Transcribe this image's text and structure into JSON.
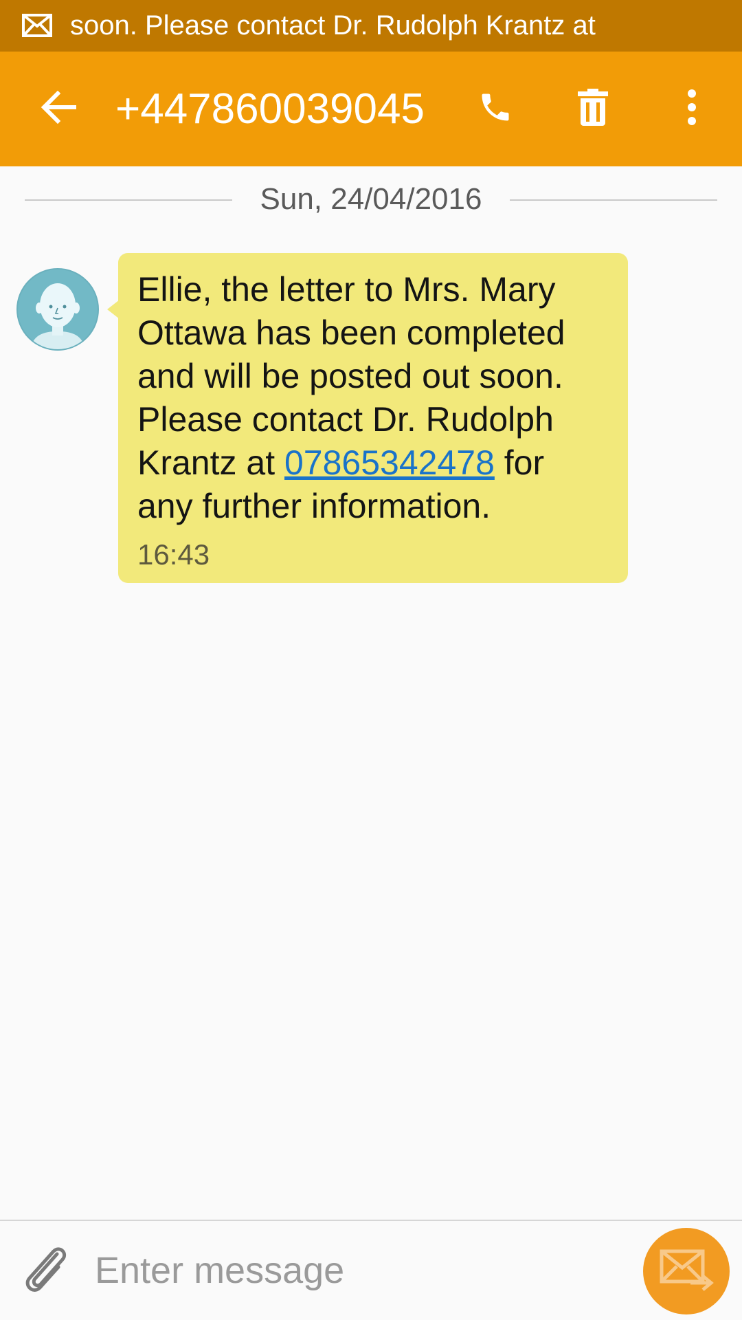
{
  "status_bar": {
    "ticker_text": "soon. Please contact Dr. Rudolph Krantz at",
    "icon": "mail-icon"
  },
  "app_bar": {
    "title": "+447860039045",
    "icons": [
      "back-arrow-icon",
      "phone-icon",
      "trash-icon",
      "more-vert-icon"
    ]
  },
  "conversation": {
    "date": "Sun, 24/04/2016",
    "messages": [
      {
        "text_before_link": "Ellie, the letter to Mrs. Mary Ottawa has been completed and will be posted out soon. Please contact Dr. Rudolph Krantz at ",
        "link": "07865342478",
        "text_after_link": " for any further information.",
        "time": "16:43"
      }
    ]
  },
  "composer": {
    "placeholder": "Enter message",
    "value": "",
    "icons": [
      "paperclip-icon",
      "send-mail-icon"
    ]
  },
  "colors": {
    "status_bar": "#bf7800",
    "app_bar": "#f29c07",
    "bubble": "#f2e97b",
    "link": "#1a73c9",
    "send_button": "#f29b22",
    "avatar": "#72b9c6"
  }
}
